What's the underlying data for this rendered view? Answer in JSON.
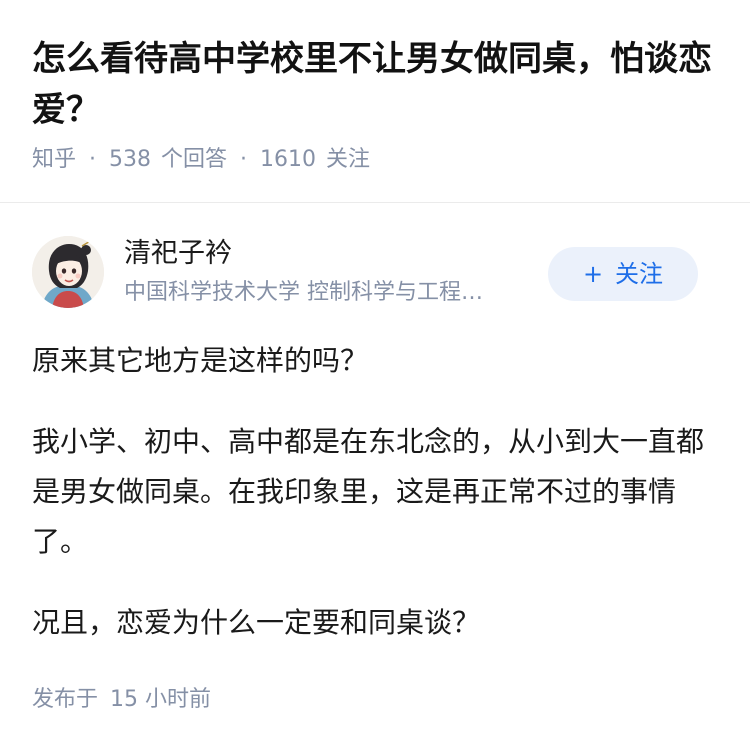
{
  "question": {
    "title": "怎么看待高中学校里不让男女做同桌，怕谈恋爱？",
    "source": "知乎",
    "separator": "·",
    "answer_count": "538",
    "answer_label": "个回答",
    "follower_count": "1610",
    "follower_label": "关注"
  },
  "author": {
    "name": "清祀子衿",
    "headline": "中国科学技术大学 控制科学与工程…",
    "follow_plus": "+",
    "follow_label": "关注",
    "avatar_icon": "avatar-illustration-icon"
  },
  "answer": {
    "paragraphs": [
      "原来其它地方是这样的吗？",
      "我小学、初中、高中都是在东北念的，从小到大一直都是男女做同桌。在我印象里，这是再正常不过的事情了。",
      "况且，恋爱为什么一定要和同桌谈？"
    ],
    "published_label": "发布于",
    "published_time": "15 小时前"
  },
  "colors": {
    "title": "#121212",
    "meta": "#8590a6",
    "accent": "#1e6ee8",
    "follow_bg": "#ebf1fb",
    "divider": "#ebebeb"
  }
}
